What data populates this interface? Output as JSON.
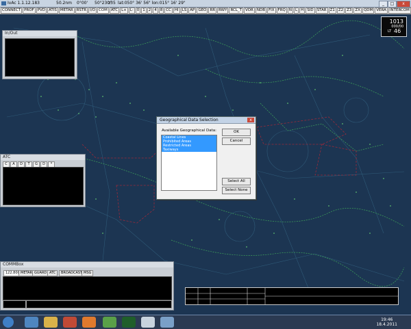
{
  "window": {
    "title": "IvAc 1.1.12.183",
    "distance": "50.2nm",
    "heading_range": "0°00'",
    "bearing": "50°230°",
    "zoom": "z35",
    "lat_lon": "lat:050° 36' 56\" lon:015° 16' 29\"",
    "controls": {
      "minimize": "_",
      "maximize": "□",
      "close": "x"
    }
  },
  "toolbar": {
    "buttons": [
      "CONNECT",
      "PROF",
      "PVD",
      "ATIS",
      "METAR",
      "RSTR",
      "I/O",
      "COM",
      "ATC",
      "L+",
      "L-",
      "0",
      "1",
      "2",
      "4",
      "8",
      "CC",
      "HI",
      "LS",
      "AP",
      "GEO",
      "RR",
      "RWY",
      "RCL_T",
      "VOR",
      "NDB",
      "FIX",
      "FRQ",
      "N",
      "L",
      "H",
      "SID",
      "STAR",
      "Z1",
      "Z2",
      "Z3",
      "ZX",
      "QDM",
      "VERA",
      "INTERCOM"
    ]
  },
  "qnh": {
    "value": "1013",
    "sub": "000/00",
    "label": "LT",
    "level": "46"
  },
  "inout": {
    "title": "In/Out"
  },
  "atc": {
    "title": "ATC",
    "columns": [
      "C",
      "A",
      "D",
      "T",
      "G",
      "D",
      "*"
    ]
  },
  "dialog": {
    "title": "Geographical Data Selection",
    "list_label": "Available Geographical Data:",
    "items": [
      "Coastal Lines",
      "Prohibited Areas",
      "Restricted Areas",
      "Taxiways"
    ],
    "ok": "OK",
    "cancel": "Cancel",
    "select_all": "Select All",
    "select_none": "Select None"
  },
  "comm": {
    "title": "COMMBox",
    "tabs": [
      "122.800",
      "METAR",
      "GUARD",
      "ATC",
      "BROADCAST",
      "MSG"
    ]
  },
  "taskbar": {
    "time": "19:46",
    "date": "18.4.2011"
  },
  "colors": {
    "radar_bg": "#1c3552",
    "coast": "#3fa65a",
    "restricted": "#9a2a3a",
    "dialog_select": "#3399ff"
  }
}
